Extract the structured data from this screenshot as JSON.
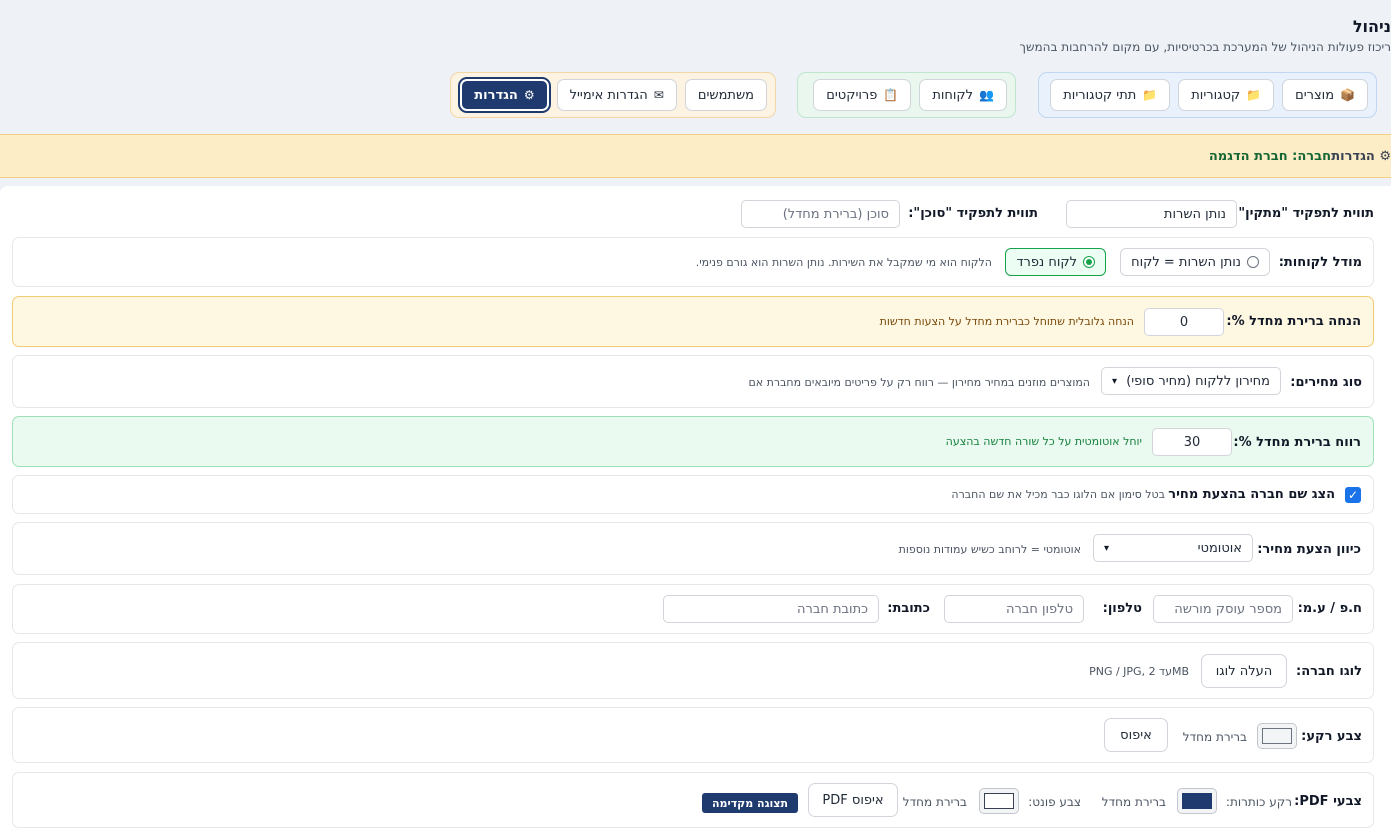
{
  "header": {
    "title": "ניהול",
    "subtitle": "ריכוז פעולות הניהול של המערכת בכרטיסיות, עם מקום להרחבות בהמשך"
  },
  "nav": {
    "group_catalog": [
      {
        "label": "מוצרים",
        "icon": "📦"
      },
      {
        "label": "קטגוריות",
        "icon": "📁"
      },
      {
        "label": "תתי קטגוריות",
        "icon": "📁"
      }
    ],
    "group_crm": [
      {
        "label": "לקוחות",
        "icon": "👥"
      },
      {
        "label": "פרויקטים",
        "icon": "📋"
      }
    ],
    "group_admin": [
      {
        "label": "משתמשים",
        "icon": ""
      },
      {
        "label": "הגדרות אימייל",
        "icon": "✉"
      },
      {
        "label": "הגדרות",
        "icon": "⚙"
      }
    ]
  },
  "banner": {
    "settings_label": "⚙ הגדרות",
    "company_label": "חברה: חברת הדגמה"
  },
  "roles": {
    "installer_label": "תווית לתפקיד \"מתקין\":",
    "installer_value": "נותן השרות",
    "agent_label": "תווית לתפקיד \"סוכן\":",
    "agent_placeholder": "סוכן (ברירת מחדל)"
  },
  "customer_model": {
    "label": "מודל לקוחות:",
    "option_same": "נותן השרות = לקוח",
    "option_separate": "לקוח נפרד",
    "hint": "הלקוח הוא מי שמקבל את השירות. נותן השרות הוא גורם פנימי."
  },
  "discount": {
    "label": "הנחה ברירת מחדל %:",
    "value": "0",
    "hint": "הנחה גלובלית שתוחל כברירת מחדל על הצעות חדשות"
  },
  "price_type": {
    "label": "סוג מחירים:",
    "value": "מחירון ללקוח (מחיר סופי)",
    "hint": "המוצרים מוזנים במחיר מחירון — רווח רק על פריטים מיובאים מחברת אם"
  },
  "margin": {
    "label": "רווח ברירת מחדל %:",
    "value": "30",
    "hint": "יוחל אוטומטית על כל שורה חדשה בהצעה"
  },
  "show_company": {
    "label": "הצג שם חברה בהצעת מחיר",
    "hint": "בטל סימון אם הלוגו כבר מכיל את שם החברה",
    "check": "✓"
  },
  "orientation": {
    "label": "כיוון הצעת מחיר:",
    "value": "אוטומטי",
    "hint": "אוטומטי = לרוחב כשיש עמודות נוספות"
  },
  "company_details": {
    "vat_label": "ח.פ / ע.מ:",
    "vat_placeholder": "מספר עוסק מורשה",
    "phone_label": "טלפון:",
    "phone_placeholder": "טלפון חברה",
    "address_label": "כתובת:",
    "address_placeholder": "כתובת חברה"
  },
  "logo": {
    "label": "לוגו חברה:",
    "button": "העלה לוגו",
    "hint": "PNG / JPG, עד 2MB"
  },
  "bg_color": {
    "label": "צבע רקע:",
    "default_text": "ברירת מחדל",
    "reset": "איפוס",
    "color": "#f3f4f6"
  },
  "pdf_colors": {
    "label": "צבעי PDF:",
    "title_bg_label": "רקע כותרות:",
    "title_bg_default": "ברירת מחדל",
    "title_bg_color": "#1e3a6e",
    "font_color_label": "צבע פונט:",
    "font_color_default": "ברירת מחדל",
    "font_color": "#ffffff",
    "reset": "איפוס PDF",
    "preview": "תצוגה מקדימה"
  },
  "icons": {
    "caret": "▾"
  }
}
